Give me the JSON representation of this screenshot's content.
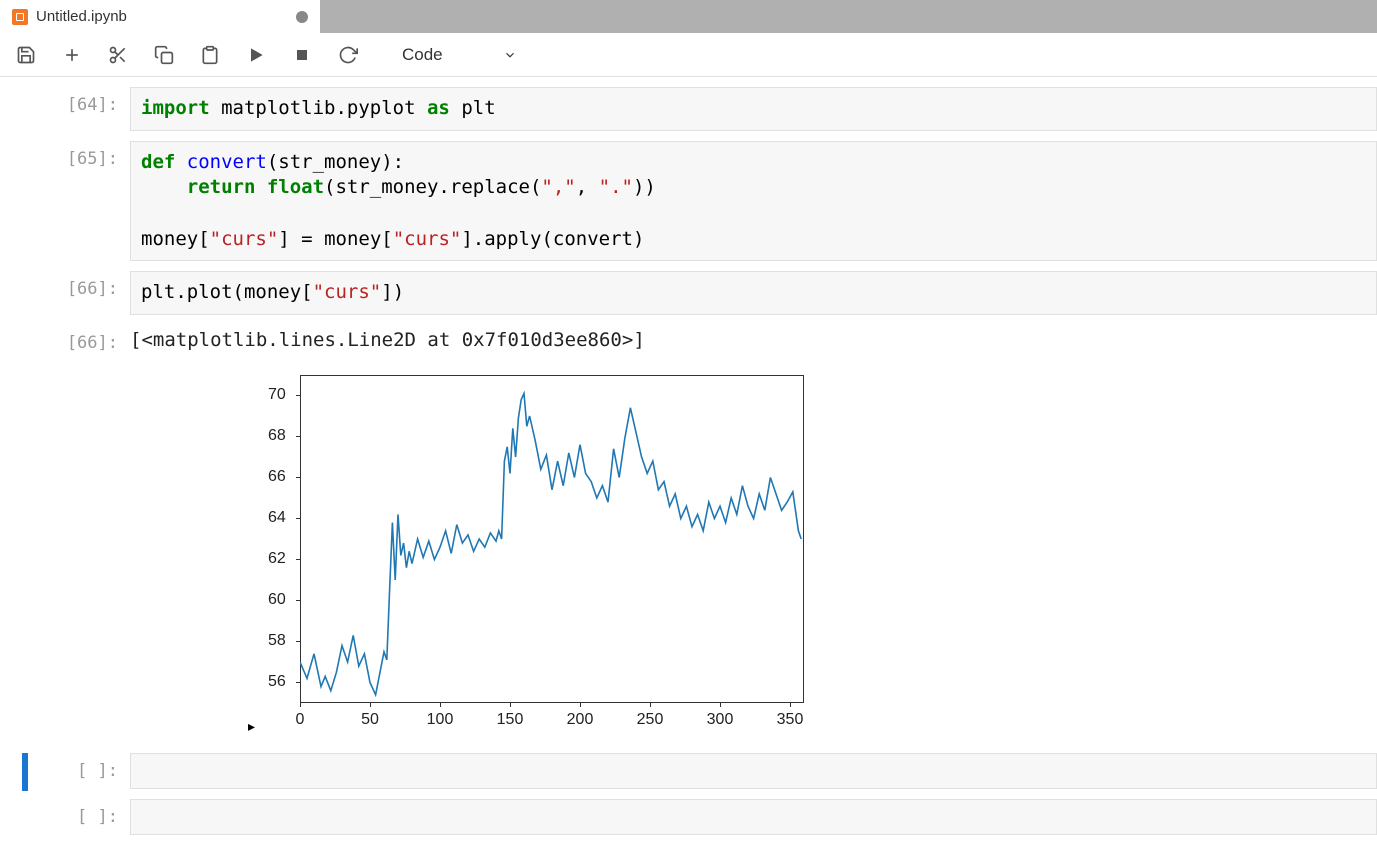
{
  "tab": {
    "title": "Untitled.ipynb"
  },
  "toolbar": {
    "cell_type": "Code"
  },
  "cells": [
    {
      "prompt": "[64]:",
      "tokens": [
        {
          "t": "import ",
          "c": "k-green"
        },
        {
          "t": "matplotlib.pyplot "
        },
        {
          "t": "as ",
          "c": "k-green"
        },
        {
          "t": "plt"
        }
      ]
    },
    {
      "prompt": "[65]:",
      "tokens": [
        {
          "t": "def ",
          "c": "k-green"
        },
        {
          "t": "convert",
          "c": "k-blue"
        },
        {
          "t": "(str_money):\n"
        },
        {
          "t": "    "
        },
        {
          "t": "return ",
          "c": "k-green"
        },
        {
          "t": "float",
          "c": "k-green"
        },
        {
          "t": "(str_money."
        },
        {
          "t": "replace"
        },
        {
          "t": "("
        },
        {
          "t": "\",\"",
          "c": "k-red"
        },
        {
          "t": ", "
        },
        {
          "t": "\".\"",
          "c": "k-red"
        },
        {
          "t": "))\n\n"
        },
        {
          "t": "money["
        },
        {
          "t": "\"curs\"",
          "c": "k-red"
        },
        {
          "t": "] "
        },
        {
          "t": "=",
          "c": ""
        },
        {
          "t": " money["
        },
        {
          "t": "\"curs\"",
          "c": "k-red"
        },
        {
          "t": "]."
        },
        {
          "t": "apply"
        },
        {
          "t": "(convert)"
        }
      ]
    },
    {
      "prompt": "[66]:",
      "tokens": [
        {
          "t": "plt."
        },
        {
          "t": "plot"
        },
        {
          "t": "(money["
        },
        {
          "t": "\"curs\"",
          "c": "k-red"
        },
        {
          "t": "])"
        }
      ]
    },
    {
      "prompt": "[66]:",
      "output_text": "[<matplotlib.lines.Line2D at 0x7f010d3ee860>]"
    },
    {
      "prompt": "[ ]:",
      "empty": true,
      "selected": true
    },
    {
      "prompt": "[ ]:",
      "empty": true
    }
  ],
  "chart_data": {
    "type": "line",
    "title": "",
    "xlabel": "",
    "ylabel": "",
    "xlim": [
      0,
      360
    ],
    "ylim": [
      55,
      71
    ],
    "xticks": [
      0,
      50,
      100,
      150,
      200,
      250,
      300,
      350
    ],
    "yticks": [
      56,
      58,
      60,
      62,
      64,
      66,
      68,
      70
    ],
    "x": [
      0,
      5,
      10,
      15,
      18,
      22,
      26,
      30,
      34,
      38,
      42,
      46,
      50,
      54,
      58,
      60,
      62,
      64,
      66,
      68,
      70,
      72,
      74,
      76,
      78,
      80,
      84,
      88,
      92,
      96,
      100,
      104,
      108,
      112,
      116,
      120,
      124,
      128,
      132,
      136,
      140,
      142,
      144,
      146,
      148,
      150,
      152,
      154,
      156,
      158,
      160,
      162,
      164,
      168,
      172,
      176,
      180,
      184,
      188,
      192,
      196,
      200,
      204,
      208,
      212,
      216,
      220,
      224,
      228,
      232,
      236,
      240,
      244,
      248,
      252,
      256,
      260,
      264,
      268,
      272,
      276,
      280,
      284,
      288,
      292,
      296,
      300,
      304,
      308,
      312,
      316,
      320,
      324,
      328,
      332,
      336,
      340,
      344,
      348,
      352,
      356,
      358
    ],
    "y": [
      57.0,
      56.2,
      57.4,
      55.8,
      56.3,
      55.6,
      56.5,
      57.8,
      57.0,
      58.3,
      56.8,
      57.4,
      56.0,
      55.4,
      56.8,
      57.5,
      57.1,
      60.5,
      63.8,
      61.0,
      64.2,
      62.2,
      62.8,
      61.6,
      62.4,
      61.8,
      63.0,
      62.1,
      62.9,
      62.0,
      62.6,
      63.4,
      62.3,
      63.7,
      62.8,
      63.2,
      62.4,
      63.0,
      62.6,
      63.3,
      62.9,
      63.4,
      63.0,
      66.8,
      67.5,
      66.2,
      68.4,
      67.0,
      68.9,
      69.8,
      70.1,
      68.5,
      69.0,
      67.8,
      66.4,
      67.1,
      65.4,
      66.8,
      65.6,
      67.2,
      66.0,
      67.6,
      66.2,
      65.8,
      65.0,
      65.6,
      64.8,
      67.4,
      66.0,
      67.9,
      69.4,
      68.2,
      67.0,
      66.2,
      66.8,
      65.4,
      65.8,
      64.6,
      65.2,
      64.0,
      64.6,
      63.6,
      64.2,
      63.4,
      64.8,
      64.0,
      64.6,
      63.8,
      65.0,
      64.2,
      65.6,
      64.6,
      64.0,
      65.2,
      64.4,
      66.0,
      65.2,
      64.4,
      64.8,
      65.3,
      63.4,
      63.0
    ]
  }
}
